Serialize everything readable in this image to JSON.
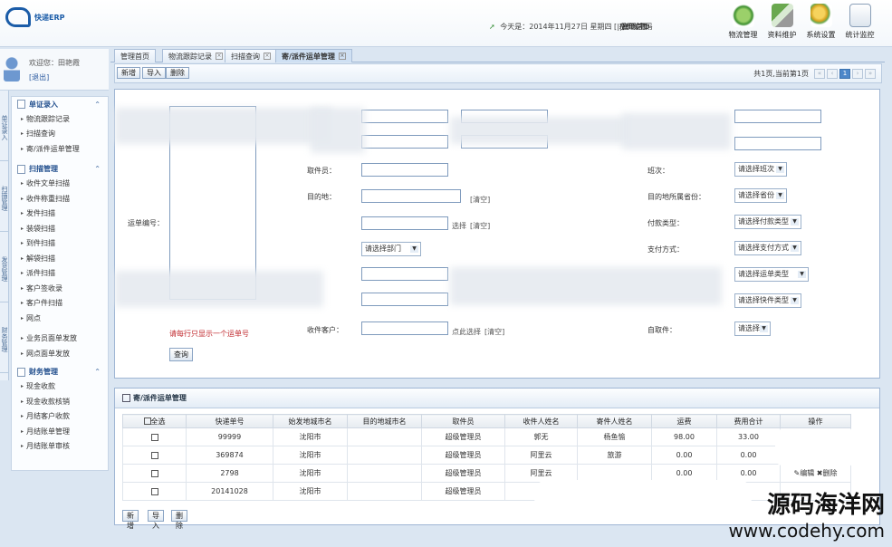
{
  "app": {
    "logo_text": "快递ERP"
  },
  "header": {
    "info_prefix": "今天是：2014年11月27日 星期四",
    "links": [
      "系统设置",
      "管理首页",
      "修改密码"
    ],
    "modules": [
      {
        "label": "物流管理",
        "icon": "logistics-icon",
        "color": "#3d8f2f"
      },
      {
        "label": "资料维护",
        "icon": "data-maintenance-icon",
        "color": "#3f7f3f"
      },
      {
        "label": "系统设置",
        "icon": "system-settings-icon",
        "color": "#d5a21f"
      },
      {
        "label": "统计监控",
        "icon": "statistics-icon",
        "color": "#8a9fb8"
      }
    ]
  },
  "user": {
    "welcome": "欢迎您：田艳霞",
    "logout": "[退出]"
  },
  "vertical_tabs": [
    "单证录入",
    "扫描管理",
    "发货管理",
    "财务管理"
  ],
  "sidebar": {
    "groups": [
      {
        "title": "单证录入",
        "items": [
          "物流跟踪记录",
          "扫描查询",
          "寄/派件运单管理"
        ]
      },
      {
        "title": "扫描管理",
        "items": [
          "收件文单扫描",
          "收件称重扫描",
          "发件扫描",
          "装袋扫描",
          "到件扫描",
          "解袋扫描",
          "派件扫描",
          "客户签收录",
          "客户件扫描",
          "网点",
          "业务员面单发放",
          "网点面单发放"
        ]
      },
      {
        "title": "财务管理",
        "items": [
          "现金收款",
          "现金收款核销",
          "月结客户收款",
          "月结账单管理",
          "月结账单审核"
        ]
      }
    ]
  },
  "tabs": [
    {
      "label": "管理首页"
    },
    {
      "label": "物流跟踪记录"
    },
    {
      "label": "扫描查询"
    },
    {
      "label": "寄/派件运单管理"
    }
  ],
  "toolbar": {
    "add": "新增",
    "import": "导入",
    "delete": "删除",
    "pager_text": "共1页,当前第1页",
    "page": "1"
  },
  "form": {
    "waybill_label": "运单编号：",
    "hint": "请每行只显示一个运单号",
    "query": "查询",
    "picker_label": "取件员：",
    "dest_label": "目的地：",
    "clear": "[清空]",
    "select": "选择",
    "dept_select": "请选择部门",
    "customer_label": "收件客户：",
    "click_select": "点此选择",
    "batch_label": "班次：",
    "batch_select": "请选择班次",
    "dest_province_label": "目的地所属省份：",
    "province_select": "请选择省份",
    "pay_type_label": "付款类型：",
    "pay_type_select": "请选择付款类型",
    "pay_method_label": "支付方式：",
    "pay_method_select": "请选择支付方式",
    "waybill_type_select": "请选择运单类型",
    "express_type_select": "请选择快件类型",
    "self_pick_label": "自取件：",
    "self_pick_select": "请选择"
  },
  "grid": {
    "title": "寄/派件运单管理",
    "select_all": "全选",
    "columns": [
      "快递单号",
      "始发地城市名",
      "目的地城市名",
      "取件员",
      "收件人姓名",
      "寄件人姓名",
      "运费",
      "费用合计",
      "操作"
    ],
    "rows": [
      {
        "no": "99999",
        "origin": "沈阳市",
        "dest": "",
        "picker": "超级管理员",
        "receiver": "郭无",
        "sender": "杨鱼愉",
        "fee": "98.00",
        "total": "33.00"
      },
      {
        "no": "369874",
        "origin": "沈阳市",
        "dest": "",
        "picker": "超级管理员",
        "receiver": "阿里云",
        "sender": "旅游",
        "fee": "0.00",
        "total": "0.00"
      },
      {
        "no": "2798",
        "origin": "沈阳市",
        "dest": "",
        "picker": "超级管理员",
        "receiver": "阿里云",
        "sender": "",
        "fee": "0.00",
        "total": "0.00"
      },
      {
        "no": "20141028",
        "origin": "沈阳市",
        "dest": "",
        "picker": "超级管理员",
        "receiver": "",
        "sender": "",
        "fee": "",
        "total": ""
      }
    ],
    "edit": "编辑",
    "delete": "删除",
    "buttons": {
      "add": "新增",
      "import": "导入",
      "delete": "删除"
    }
  },
  "watermark": {
    "line1": "源码海洋网",
    "line2": "www.codehy.com"
  }
}
